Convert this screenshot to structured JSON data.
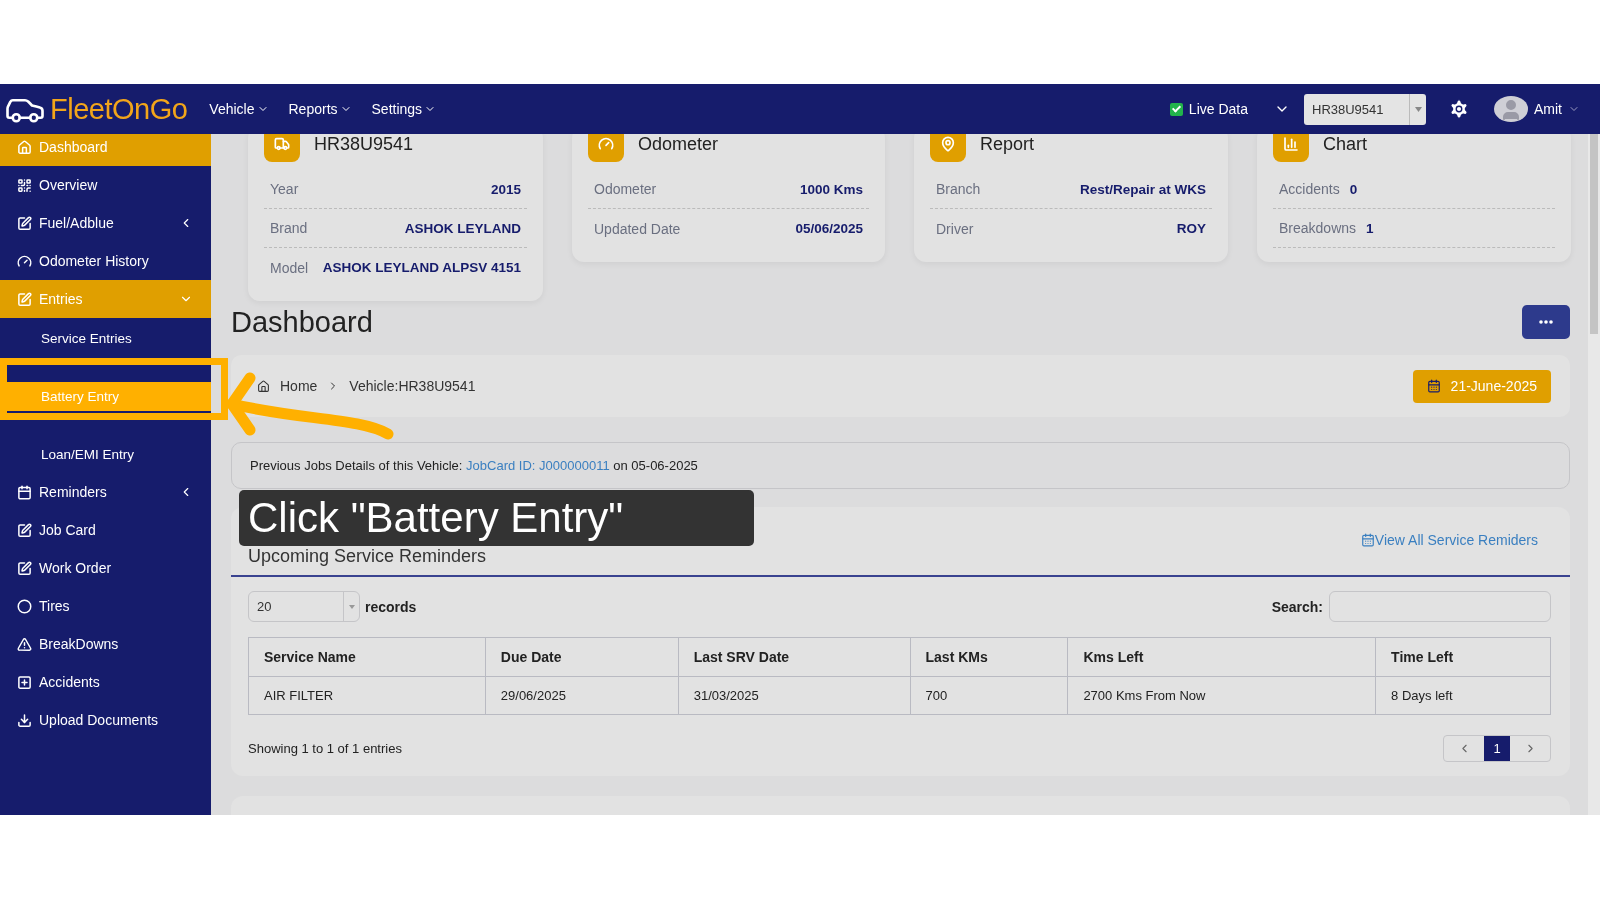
{
  "header": {
    "logo": "FleetOnGo",
    "menu": [
      {
        "label": "Vehicle"
      },
      {
        "label": "Reports"
      },
      {
        "label": "Settings"
      }
    ],
    "live_data": {
      "label": "Live Data",
      "checked": true
    },
    "vehicle_select": "HR38U9541",
    "user": "Amit"
  },
  "sidebar": {
    "items": [
      {
        "label": "Dashboard",
        "selected": true
      },
      {
        "label": "Overview",
        "selected": false
      },
      {
        "label": "Fuel/Adblue",
        "selected": false,
        "expanded": false
      },
      {
        "label": "Odometer History",
        "selected": false
      },
      {
        "label": "Entries",
        "selected": true,
        "expanded": true,
        "children": [
          {
            "label": "Service Entries",
            "highlighted": false
          },
          {
            "label": "Battery Entry",
            "highlighted": true
          },
          {
            "label": "Loan/EMI Entry",
            "highlighted": false
          }
        ]
      },
      {
        "label": "Reminders",
        "selected": false,
        "expanded": false
      },
      {
        "label": "Job Card",
        "selected": false
      },
      {
        "label": "Work Order",
        "selected": false
      },
      {
        "label": "Tires",
        "selected": false
      },
      {
        "label": "BreakDowns",
        "selected": false
      },
      {
        "label": "Accidents",
        "selected": false
      },
      {
        "label": "Upload Documents",
        "selected": false
      }
    ]
  },
  "cards": [
    {
      "title": "HR38U9541",
      "kind": "spread",
      "rows": [
        {
          "label": "Year",
          "value": "2015"
        },
        {
          "label": "Brand",
          "value": "ASHOK LEYLAND"
        },
        {
          "label": "Model",
          "value": "ASHOK LEYLAND ALPSV 4151"
        }
      ]
    },
    {
      "title": "Odometer",
      "kind": "spread",
      "rows": [
        {
          "label": "Odometer",
          "value": "1000 Kms"
        },
        {
          "label": "Updated Date",
          "value": "05/06/2025"
        }
      ]
    },
    {
      "title": "Report",
      "kind": "spread",
      "rows": [
        {
          "label": "Branch",
          "value": "Rest/Repair at WKS"
        },
        {
          "label": "Driver",
          "value": "ROY"
        }
      ]
    },
    {
      "title": "Chart",
      "kind": "inline",
      "rows": [
        {
          "label": "Accidents",
          "value": "0"
        },
        {
          "label": "Breakdowns",
          "value": "1"
        }
      ]
    }
  ],
  "page_title": "Dashboard",
  "breadcrumb": [
    "Home",
    "Vehicle:HR38U9541"
  ],
  "date_button": "21-June-2025",
  "previous_jobs": {
    "text": "Previous Jobs Details of this Vehicle:",
    "link": "JobCard ID: J000000011",
    "suffix": "on 05-06-2025"
  },
  "reminders": {
    "title": "Upcoming Service Reminders",
    "view_all": "View All Service Remiders",
    "page_size": "20",
    "records_label": "records",
    "search_label": "Search:",
    "table": {
      "columns": [
        "Service Name",
        "Due Date",
        "Last SRV Date",
        "Last KMs",
        "Kms Left",
        "Time Left"
      ],
      "rows": [
        [
          "AIR FILTER",
          "29/06/2025",
          "31/03/2025",
          "700",
          "2700 Kms From Now",
          "8 Days left"
        ]
      ]
    },
    "footer": "Showing 1 to 1 of 1 entries",
    "pages": [
      {
        "label": "1",
        "selected": true
      }
    ]
  },
  "tooltip": "Click \"Battery Entry\""
}
